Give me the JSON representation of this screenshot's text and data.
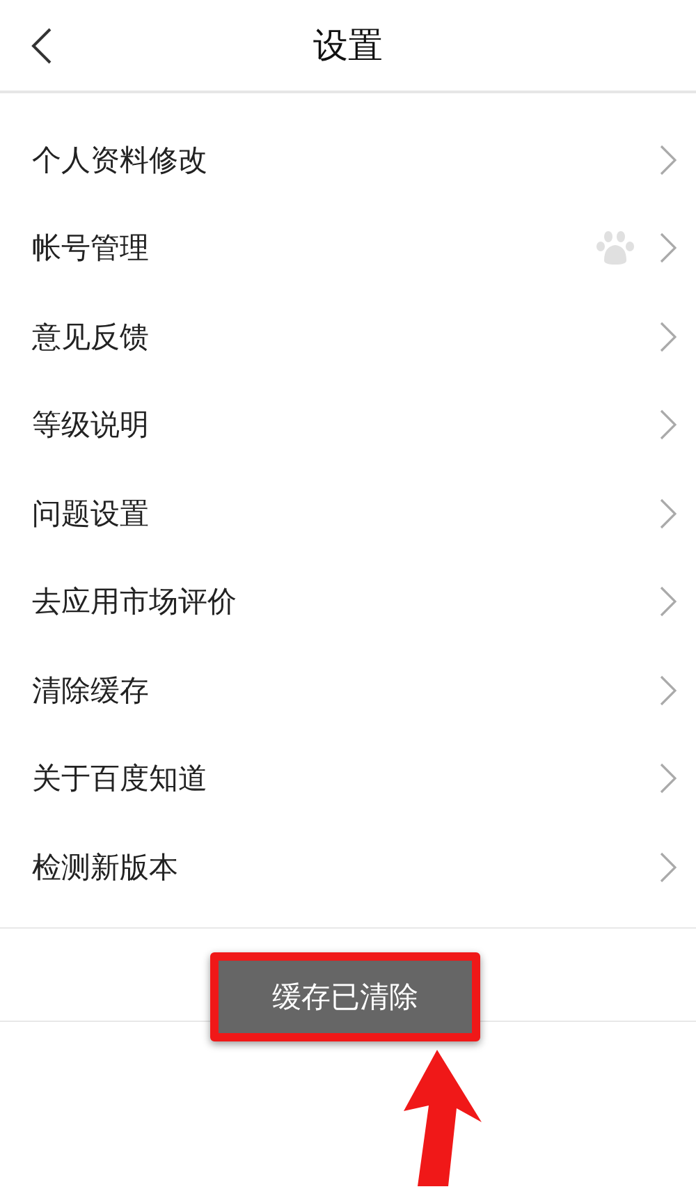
{
  "header": {
    "title": "设置"
  },
  "items": [
    {
      "label": "个人资料修改",
      "badge": false
    },
    {
      "label": "帐号管理",
      "badge": true
    },
    {
      "label": "意见反馈",
      "badge": false
    },
    {
      "label": "等级说明",
      "badge": false
    },
    {
      "label": "问题设置",
      "badge": false
    },
    {
      "label": "去应用市场评价",
      "badge": false
    },
    {
      "label": "清除缓存",
      "badge": false
    },
    {
      "label": "关于百度知道",
      "badge": false
    },
    {
      "label": "检测新版本",
      "badge": false
    }
  ],
  "toast": {
    "message": "缓存已清除"
  }
}
